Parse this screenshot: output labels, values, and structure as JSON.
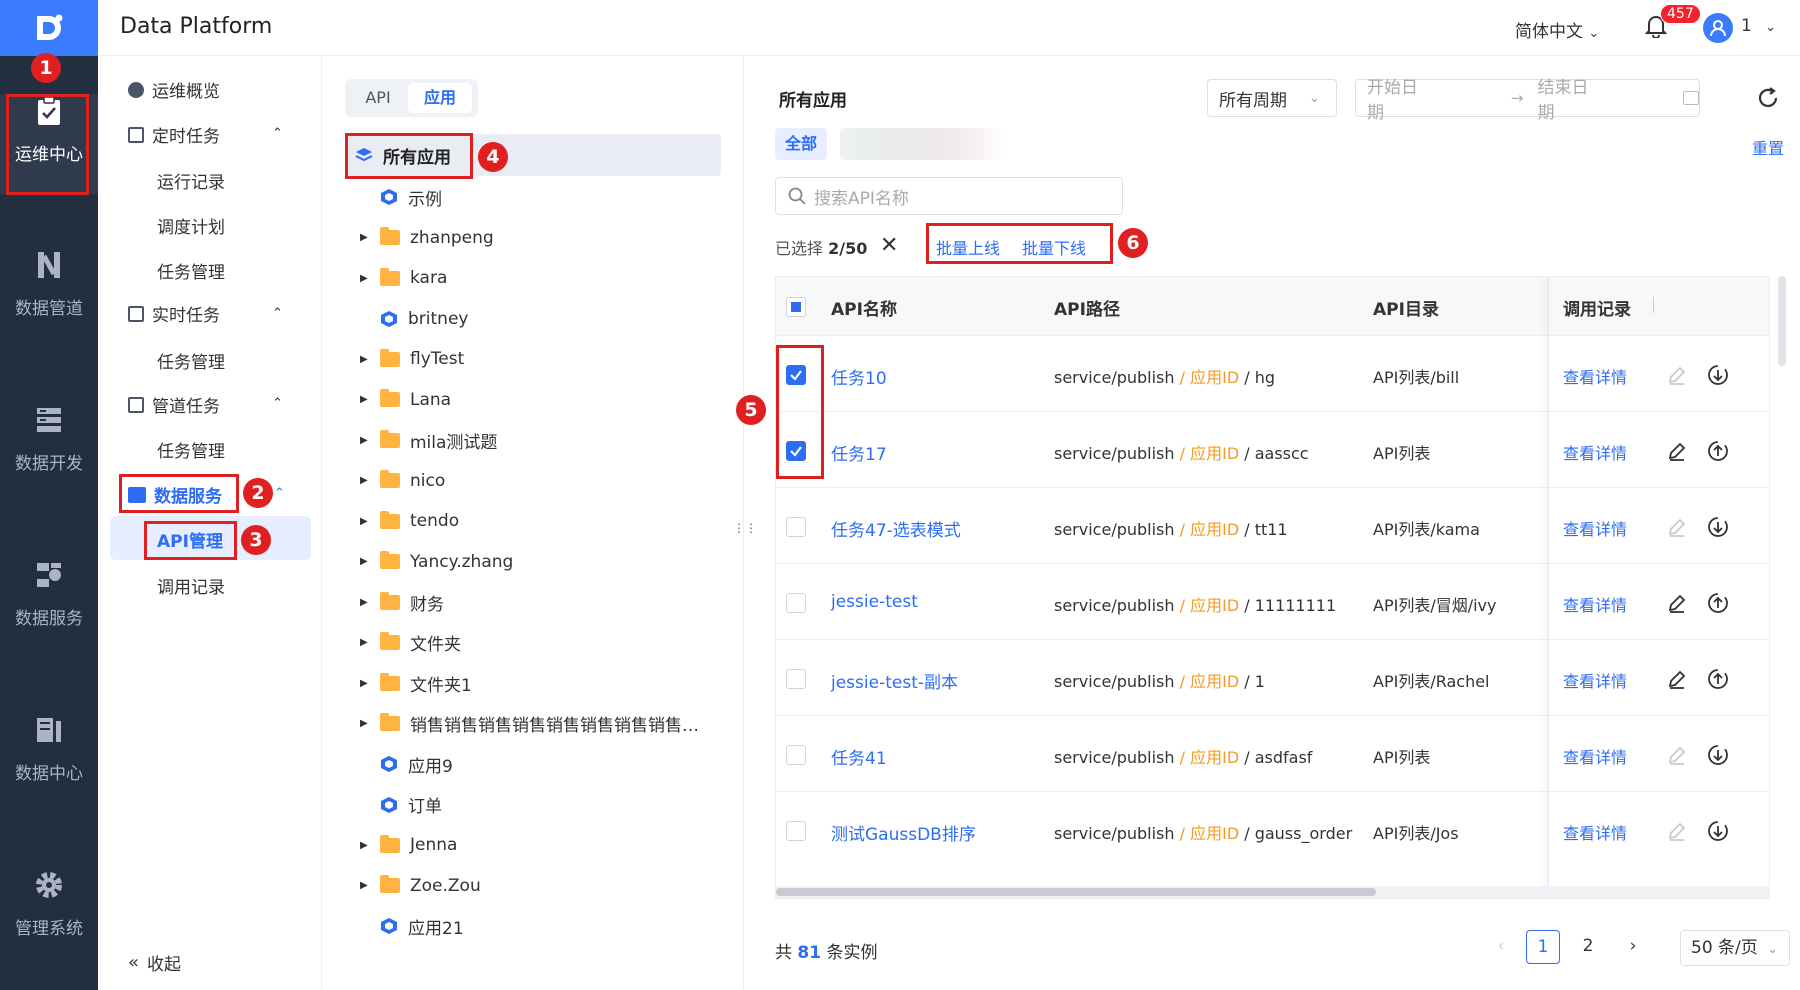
{
  "header": {
    "app_title": "Data Platform",
    "language": "简体中文",
    "notification_count": "457",
    "user_name": "1"
  },
  "rail": {
    "items": [
      {
        "label": "运维中心",
        "icon": "clipboard-icon",
        "active": true
      },
      {
        "label": "数据管道",
        "icon": "pipeline-icon"
      },
      {
        "label": "数据开发",
        "icon": "dev-icon"
      },
      {
        "label": "数据服务",
        "icon": "service-icon"
      },
      {
        "label": "数据中心",
        "icon": "datacenter-icon"
      },
      {
        "label": "管理系统",
        "icon": "gear-icon"
      }
    ]
  },
  "sidebar": {
    "overview": "运维概览",
    "scheduled": "定时任务",
    "run_records": "运行记录",
    "schedule_plan": "调度计划",
    "task_mgmt_1": "任务管理",
    "realtime": "实时任务",
    "task_mgmt_2": "任务管理",
    "pipeline": "管道任务",
    "task_mgmt_3": "任务管理",
    "data_service": "数据服务",
    "api_mgmt": "API管理",
    "call_records": "调用记录",
    "collapse": "收起"
  },
  "tree": {
    "tab_api": "API",
    "tab_app": "应用",
    "all_apps": "所有应用",
    "items": [
      {
        "label": "示例",
        "type": "app",
        "expand": false
      },
      {
        "label": "zhanpeng",
        "type": "folder",
        "expand": true
      },
      {
        "label": "kara",
        "type": "folder",
        "expand": true
      },
      {
        "label": "britney",
        "type": "app",
        "expand": false
      },
      {
        "label": "flyTest",
        "type": "folder",
        "expand": true
      },
      {
        "label": "Lana",
        "type": "folder",
        "expand": true
      },
      {
        "label": "mila测试题",
        "type": "folder",
        "expand": true
      },
      {
        "label": "nico",
        "type": "folder",
        "expand": true
      },
      {
        "label": "tendo",
        "type": "folder",
        "expand": true
      },
      {
        "label": "Yancy.zhang",
        "type": "folder",
        "expand": true
      },
      {
        "label": "财务",
        "type": "folder",
        "expand": true
      },
      {
        "label": "文件夹",
        "type": "folder",
        "expand": true
      },
      {
        "label": "文件夹1",
        "type": "folder",
        "expand": true
      },
      {
        "label": "销售销售销售销售销售销售销售销售…",
        "type": "folder",
        "expand": true
      },
      {
        "label": "应用9",
        "type": "app",
        "expand": false
      },
      {
        "label": "订单",
        "type": "app",
        "expand": false
      },
      {
        "label": "Jenna",
        "type": "folder",
        "expand": true
      },
      {
        "label": "Zoe.Zou",
        "type": "folder",
        "expand": true
      },
      {
        "label": "应用21",
        "type": "app",
        "expand": false
      }
    ]
  },
  "main": {
    "title": "所有应用",
    "period_select": "所有周期",
    "start_date_placeholder": "开始日期",
    "end_date_placeholder": "结束日期",
    "all_button": "全部",
    "reset": "重置",
    "search_placeholder": "搜索API名称",
    "selected_prefix": "已选择 ",
    "selected_count": "2/50",
    "batch_online": "批量上线",
    "batch_offline": "批量下线",
    "columns": {
      "name": "API名称",
      "path": "API路径",
      "dir": "API目录",
      "calls": "调用记录"
    },
    "rows": [
      {
        "name": "任务10",
        "path_prefix": "service/publish",
        "app_id": "应用ID",
        "path_suffix": "hg",
        "dir": "API列表/bill",
        "detail": "查看详情",
        "checked": true,
        "edit_enabled": false,
        "online": false
      },
      {
        "name": "任务17",
        "path_prefix": "service/publish",
        "app_id": "应用ID",
        "path_suffix": "aasscc",
        "dir": "API列表",
        "detail": "查看详情",
        "checked": true,
        "edit_enabled": true,
        "online": true
      },
      {
        "name": "任务47-选表模式",
        "path_prefix": "service/publish",
        "app_id": "应用ID",
        "path_suffix": "tt11",
        "dir": "API列表/kama",
        "detail": "查看详情",
        "checked": false,
        "edit_enabled": false,
        "online": false
      },
      {
        "name": "jessie-test",
        "path_prefix": "service/publish",
        "app_id": "应用ID",
        "path_suffix": "11111111",
        "dir": "API列表/冒烟/ivy",
        "detail": "查看详情",
        "checked": false,
        "edit_enabled": true,
        "online": true
      },
      {
        "name": "jessie-test-副本",
        "path_prefix": "service/publish",
        "app_id": "应用ID",
        "path_suffix": "1",
        "dir": "API列表/Rachel",
        "detail": "查看详情",
        "checked": false,
        "edit_enabled": true,
        "online": true
      },
      {
        "name": "任务41",
        "path_prefix": "service/publish",
        "app_id": "应用ID",
        "path_suffix": "asdfasf",
        "dir": "API列表",
        "detail": "查看详情",
        "checked": false,
        "edit_enabled": false,
        "online": false
      },
      {
        "name": "测试GaussDB排序",
        "path_prefix": "service/publish",
        "app_id": "应用ID",
        "path_suffix": "gauss_order",
        "dir": "API列表/Jos",
        "detail": "查看详情",
        "checked": false,
        "edit_enabled": false,
        "online": false
      }
    ],
    "total_prefix": "共 ",
    "total_count": "81",
    "total_suffix": " 条实例",
    "pages": [
      "1",
      "2"
    ],
    "current_page": "1",
    "page_size": "50 条/页"
  },
  "annotations": [
    "1",
    "2",
    "3",
    "4",
    "5",
    "6"
  ],
  "colors": {
    "accent": "#2d6cf5",
    "rail_bg": "#232e3e",
    "annotation": "#e02020",
    "path_highlight": "#f59a23"
  }
}
